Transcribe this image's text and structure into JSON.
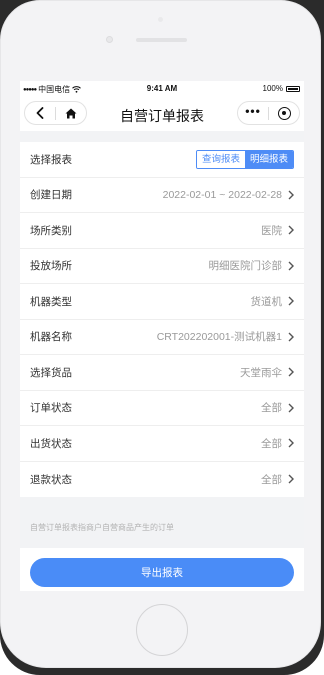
{
  "statusbar": {
    "carrier": "中国电信",
    "time": "9:41 AM",
    "battery": "100%"
  },
  "navbar": {
    "title": "自营订单报表",
    "back_icon": "chevron-left-icon",
    "home_icon": "home-icon",
    "more_icon": "more-dots-icon",
    "close_icon": "target-circle-icon"
  },
  "form": {
    "report_select": {
      "label": "选择报表",
      "options": [
        "查询报表",
        "明细报表"
      ],
      "selected": "明细报表"
    },
    "rows": [
      {
        "label": "创建日期",
        "value": "2022-02-01 ~ 2022-02-28"
      },
      {
        "label": "场所类别",
        "value": "医院"
      },
      {
        "label": "投放场所",
        "value": "明细医院门诊部"
      },
      {
        "label": "机器类型",
        "value": "货道机"
      },
      {
        "label": "机器名称",
        "value": "CRT202202001-测试机器1"
      },
      {
        "label": "选择货品",
        "value": "天堂雨伞"
      },
      {
        "label": "订单状态",
        "value": "全部"
      },
      {
        "label": "出货状态",
        "value": "全部"
      },
      {
        "label": "退款状态",
        "value": "全部"
      }
    ]
  },
  "note": "自营订单报表指商户自营商品产生的订单",
  "export_button": "导出报表",
  "colors": {
    "accent": "#4a8cf7",
    "label": "#333333",
    "value": "#9a9a9a"
  }
}
